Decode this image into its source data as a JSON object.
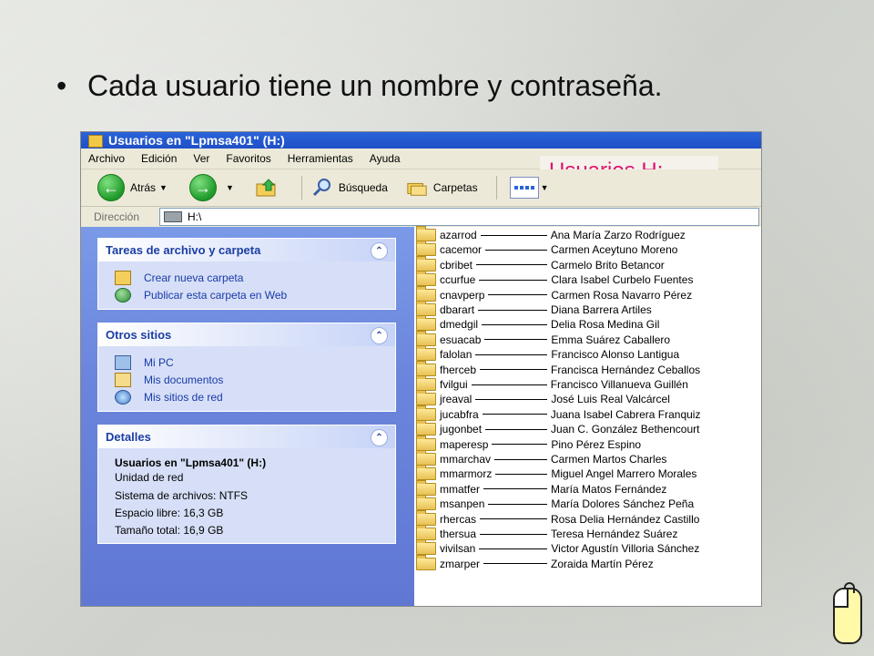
{
  "slide": {
    "bullet_text": "Cada usuario tiene un nombre y contraseña."
  },
  "window": {
    "title": "Usuarios en \"Lpmsa401\" (H:)",
    "overlay_title": "Usuarios H:",
    "menu": [
      "Archivo",
      "Edición",
      "Ver",
      "Favoritos",
      "Herramientas",
      "Ayuda"
    ],
    "toolbar": {
      "back_label": "Atrás",
      "search_label": "Búsqueda",
      "folders_label": "Carpetas"
    },
    "address": {
      "label": "Dirección",
      "value": "H:\\"
    },
    "tasks_panel": {
      "title": "Tareas de archivo y carpeta",
      "items": [
        "Crear nueva carpeta",
        "Publicar esta carpeta en Web"
      ]
    },
    "places_panel": {
      "title": "Otros sitios",
      "items": [
        "Mi PC",
        "Mis documentos",
        "Mis sitios de red"
      ]
    },
    "details_panel": {
      "title": "Detalles",
      "name": "Usuarios en \"Lpmsa401\" (H:)",
      "type": "Unidad de red",
      "filesystem": "Sistema de archivos: NTFS",
      "free": "Espacio libre: 16,3 GB",
      "total": "Tamaño total: 16,9 GB"
    },
    "folders": [
      {
        "login": "azarrod",
        "name": "Ana María Zarzo Rodríguez"
      },
      {
        "login": "cacemor",
        "name": "Carmen Aceytuno Moreno"
      },
      {
        "login": "cbribet",
        "name": "Carmelo Brito Betancor"
      },
      {
        "login": "ccurfue",
        "name": "Clara Isabel Curbelo Fuentes"
      },
      {
        "login": "cnavperp",
        "name": "Carmen Rosa Navarro Pérez"
      },
      {
        "login": "dbarart",
        "name": "Diana Barrera Artiles"
      },
      {
        "login": "dmedgil",
        "name": "Delia Rosa Medina Gil"
      },
      {
        "login": "esuacab",
        "name": "Emma Suárez Caballero"
      },
      {
        "login": "falolan",
        "name": "Francisco Alonso Lantigua"
      },
      {
        "login": "fherceb",
        "name": "Francisca Hernández Ceballos"
      },
      {
        "login": "fvilgui",
        "name": "Francisco Villanueva Guillén"
      },
      {
        "login": "jreaval",
        "name": "José Luis Real Valcárcel"
      },
      {
        "login": "jucabfra",
        "name": "Juana Isabel Cabrera Franquiz"
      },
      {
        "login": "jugonbet",
        "name": "Juan C. González Bethencourt"
      },
      {
        "login": "maperesp",
        "name": "Pino Pérez Espino"
      },
      {
        "login": "mmarchav",
        "name": "Carmen Martos Charles"
      },
      {
        "login": "mmarmorz",
        "name": "Miguel Angel Marrero Morales"
      },
      {
        "login": "mmatfer",
        "name": "María Matos Fernández"
      },
      {
        "login": "msanpen",
        "name": "María Dolores Sánchez Peña"
      },
      {
        "login": "rhercas",
        "name": "Rosa Delia Hernández Castillo"
      },
      {
        "login": "thersua",
        "name": "Teresa Hernández Suárez"
      },
      {
        "login": "vivilsan",
        "name": "Victor Agustín Villoria Sánchez"
      },
      {
        "login": "zmarper",
        "name": "Zoraida Martín Pérez"
      }
    ]
  }
}
